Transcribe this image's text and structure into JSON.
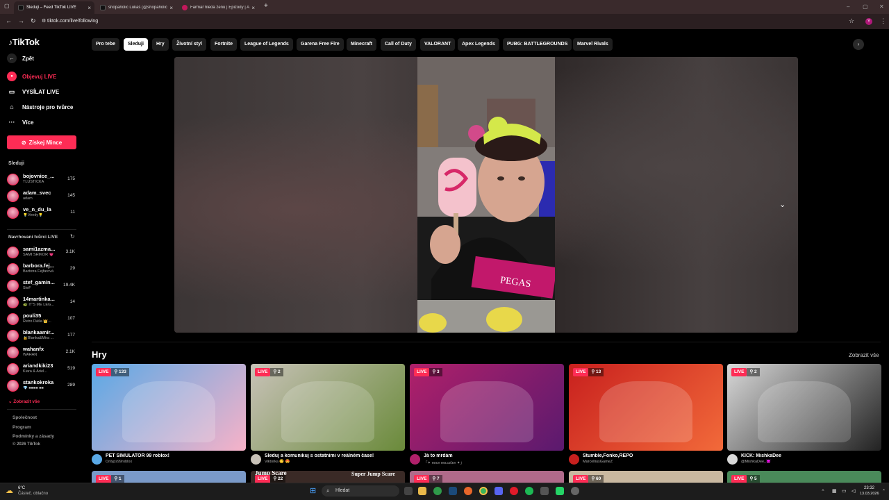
{
  "browser": {
    "tabs": [
      {
        "title": "Sleduji – Feed TikTok LIVE",
        "active": true
      },
      {
        "title": "shopaholic Lukáš (@shopaholic",
        "active": false
      },
      {
        "title": "Farmář hledá ženu | Epizody | A",
        "active": false
      }
    ],
    "new_tab": "+",
    "url": "tiktok.com/live/following",
    "profile_initial": "Y"
  },
  "sidebar": {
    "logo": "TikTok",
    "back": "Zpět",
    "nav": [
      {
        "label": "Objevuj LIVE",
        "icon": "live-icon",
        "active": true
      },
      {
        "label": "VYSÍLAT LIVE",
        "icon": "camera-icon",
        "active": false
      },
      {
        "label": "Nástroje pro tvůrce",
        "icon": "home-icon",
        "active": false
      },
      {
        "label": "Více",
        "icon": "more-icon",
        "active": false
      }
    ],
    "coins_button": "Získej Mince",
    "following_heading": "Sleduji",
    "following": [
      {
        "name": "bojovnice_...",
        "sub": "TLUSTIČKA",
        "count": "175"
      },
      {
        "name": "adam_svec",
        "sub": "adam",
        "count": "145"
      },
      {
        "name": "ve_n_du_la",
        "sub": "💡Vendy💡",
        "count": "11"
      }
    ],
    "suggested_heading": "Navrhovaní tvůrci LIVE",
    "suggested": [
      {
        "name": "sami1azma...",
        "sub": "SAMI SHIKOR 💗",
        "count": "3.1K"
      },
      {
        "name": "barbora.fej...",
        "sub": "Barbora Fejfarová",
        "count": "29"
      },
      {
        "name": "stef_gamin...",
        "sub": "SteF",
        "count": "19.4K"
      },
      {
        "name": "14martinka...",
        "sub": "🐢 IT'S ME LEG...",
        "count": "14"
      },
      {
        "name": "pouli35",
        "sub": "Retro Dáša 👑...",
        "count": "107"
      },
      {
        "name": "blankaamir...",
        "sub": "🔒Blanka&Mira ...",
        "count": "177"
      },
      {
        "name": "wahanfx",
        "sub": "WAHAN",
        "count": "2.1K"
      },
      {
        "name": "ariandkiki23",
        "sub": "Kiara & Ariel...",
        "count": "519"
      },
      {
        "name": "stankokroka",
        "sub": "💎 ■■■■ ■■",
        "count": "289"
      }
    ],
    "show_all": "Zobrazit vše",
    "footer": [
      "Společnost",
      "Program",
      "Podmínky a zásady",
      "© 2026 TikTok"
    ]
  },
  "categories": [
    "Pro tebe",
    "Sleduji",
    "Hry",
    "Životní styl",
    "Fortnite",
    "League of Legends",
    "Garena Free Fire",
    "Minecraft",
    "Call of Duty",
    "VALORANT",
    "Apex Legends",
    "PUBG: BATTLEGROUNDS",
    "Marvel Rivals"
  ],
  "active_category": "Sleduji",
  "games": {
    "title": "Hry",
    "show_all": "Zobrazit vše",
    "live_label": "LIVE",
    "cards": [
      {
        "viewers": "133",
        "title": "PET SIMULATOR 99 roblox!",
        "user": "Onlyps99roblox",
        "colors": [
          "#5aa9e6",
          "#f7b2c8"
        ]
      },
      {
        "viewers": "2",
        "title": "Sleduj a komunikuj s ostatními v reálném čase!",
        "user": "Viktorka 😊 😍",
        "colors": [
          "#c8c2b8",
          "#6a8a3a"
        ]
      },
      {
        "viewers": "3",
        "title": "Já to mrdám",
        "user": "「✦ ʜᴏᴄʜ ʜᴏʟᴄɪčᴋᴀ ✦」",
        "colors": [
          "#b0206a",
          "#5a1a6e"
        ]
      },
      {
        "viewers": "13",
        "title": "Stumble,Fonko,REPO",
        "user": "MarcelliusGameZ",
        "colors": [
          "#c8201e",
          "#f26a3a"
        ]
      },
      {
        "viewers": "2",
        "title": "KICK: MishkaDee",
        "user": "@MishkaDee_😈",
        "colors": [
          "#d8d8d8",
          "#222222"
        ]
      }
    ],
    "second_row": [
      {
        "viewers": "1"
      },
      {
        "viewers": "22",
        "overlay": "Jump Scare",
        "overlay2": "Super Jump Scare"
      },
      {
        "viewers": "7"
      },
      {
        "viewers": "60"
      },
      {
        "viewers": "5"
      }
    ]
  },
  "taskbar": {
    "weather_temp": "6°C",
    "weather_desc": "Částeč. oblačno",
    "search": "Hledat",
    "time": "23:32",
    "date": "13.03.2026"
  }
}
